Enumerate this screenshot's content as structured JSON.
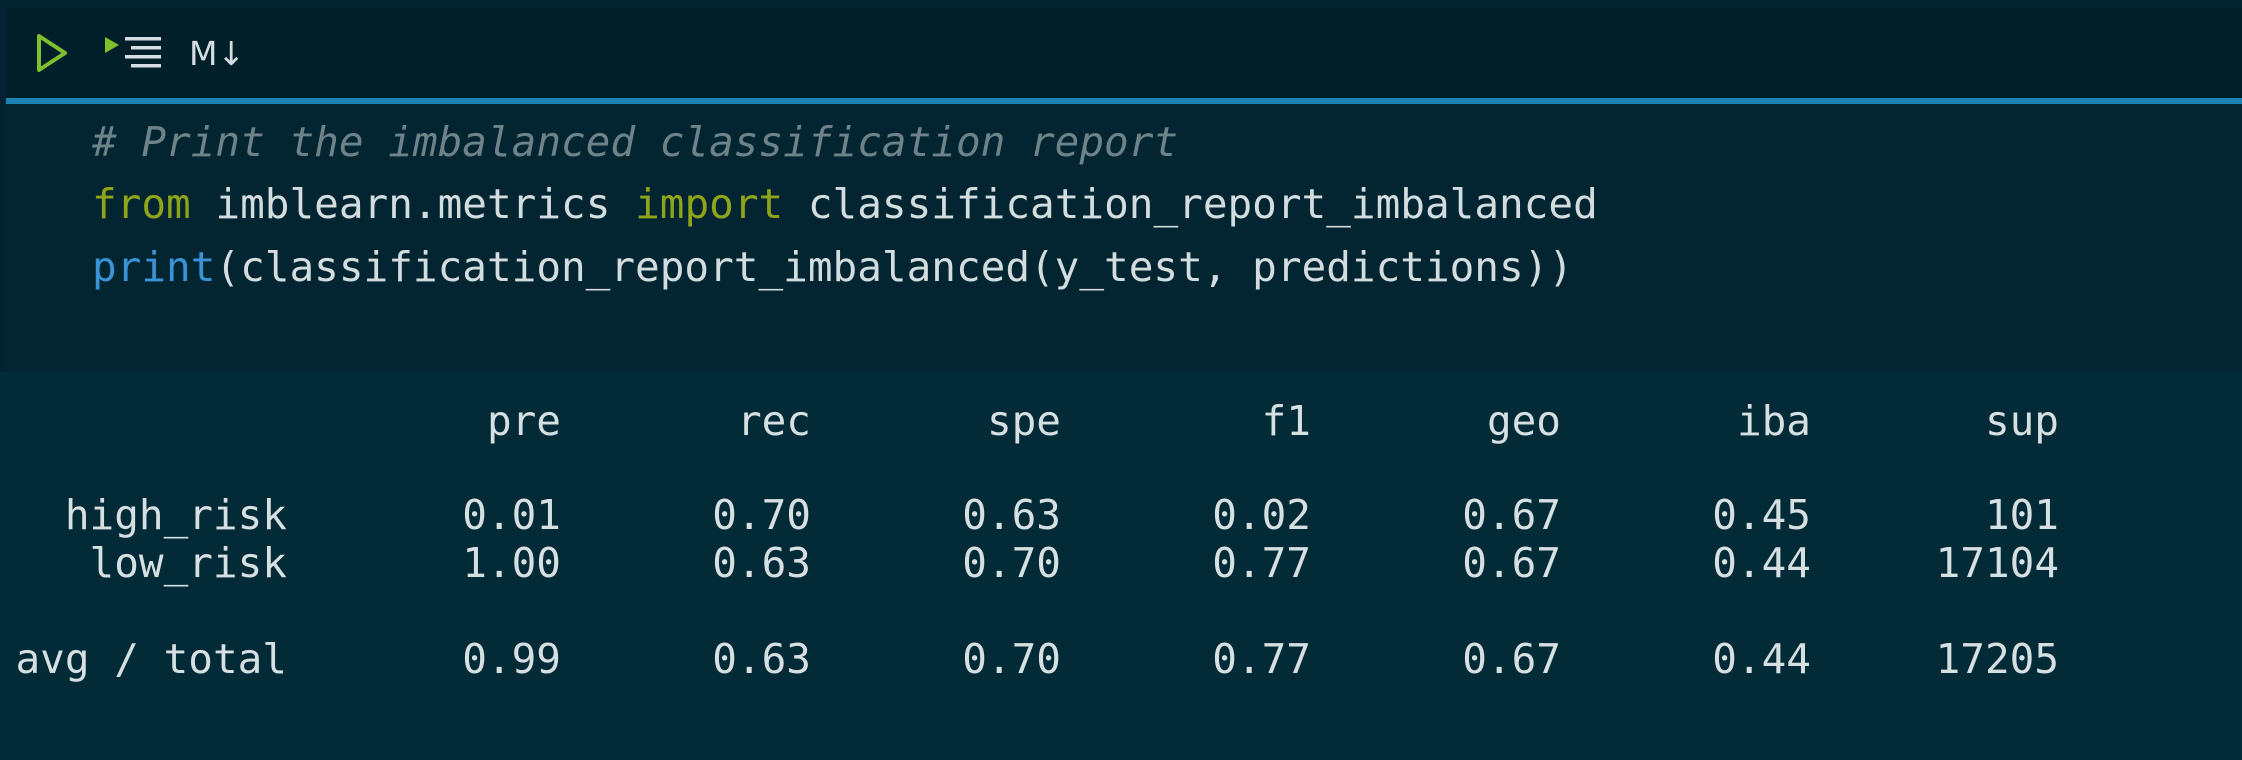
{
  "toolbar": {
    "run_icon": "play-triangle-icon",
    "run_all_icon": "run-all-lines-icon",
    "markdown_label": "M↓"
  },
  "colors": {
    "accent_line": "#1b84b4",
    "keyword": "#8fa41a",
    "builtin": "#3a93d6",
    "comment": "#6d8289",
    "run_icon": "#7ec02e"
  },
  "code": {
    "comment": "# Print the imbalanced classification report",
    "line2": {
      "kw_from": "from",
      "module": " imblearn.metrics ",
      "kw_import": "import",
      "name": " classification_report_imbalanced"
    },
    "line3": {
      "builtin": "print",
      "rest": "(classification_report_imbalanced(y_test, predictions))"
    }
  },
  "report": {
    "headers": [
      "pre",
      "rec",
      "spe",
      "f1",
      "geo",
      "iba",
      "sup"
    ],
    "rows": [
      {
        "label": "high_risk",
        "values": [
          "0.01",
          "0.70",
          "0.63",
          "0.02",
          "0.67",
          "0.45",
          "101"
        ]
      },
      {
        "label": "low_risk",
        "values": [
          "1.00",
          "0.63",
          "0.70",
          "0.77",
          "0.67",
          "0.44",
          "17104"
        ]
      }
    ],
    "total": {
      "label": "avg / total",
      "values": [
        "0.99",
        "0.63",
        "0.70",
        "0.77",
        "0.67",
        "0.44",
        "17205"
      ]
    }
  }
}
